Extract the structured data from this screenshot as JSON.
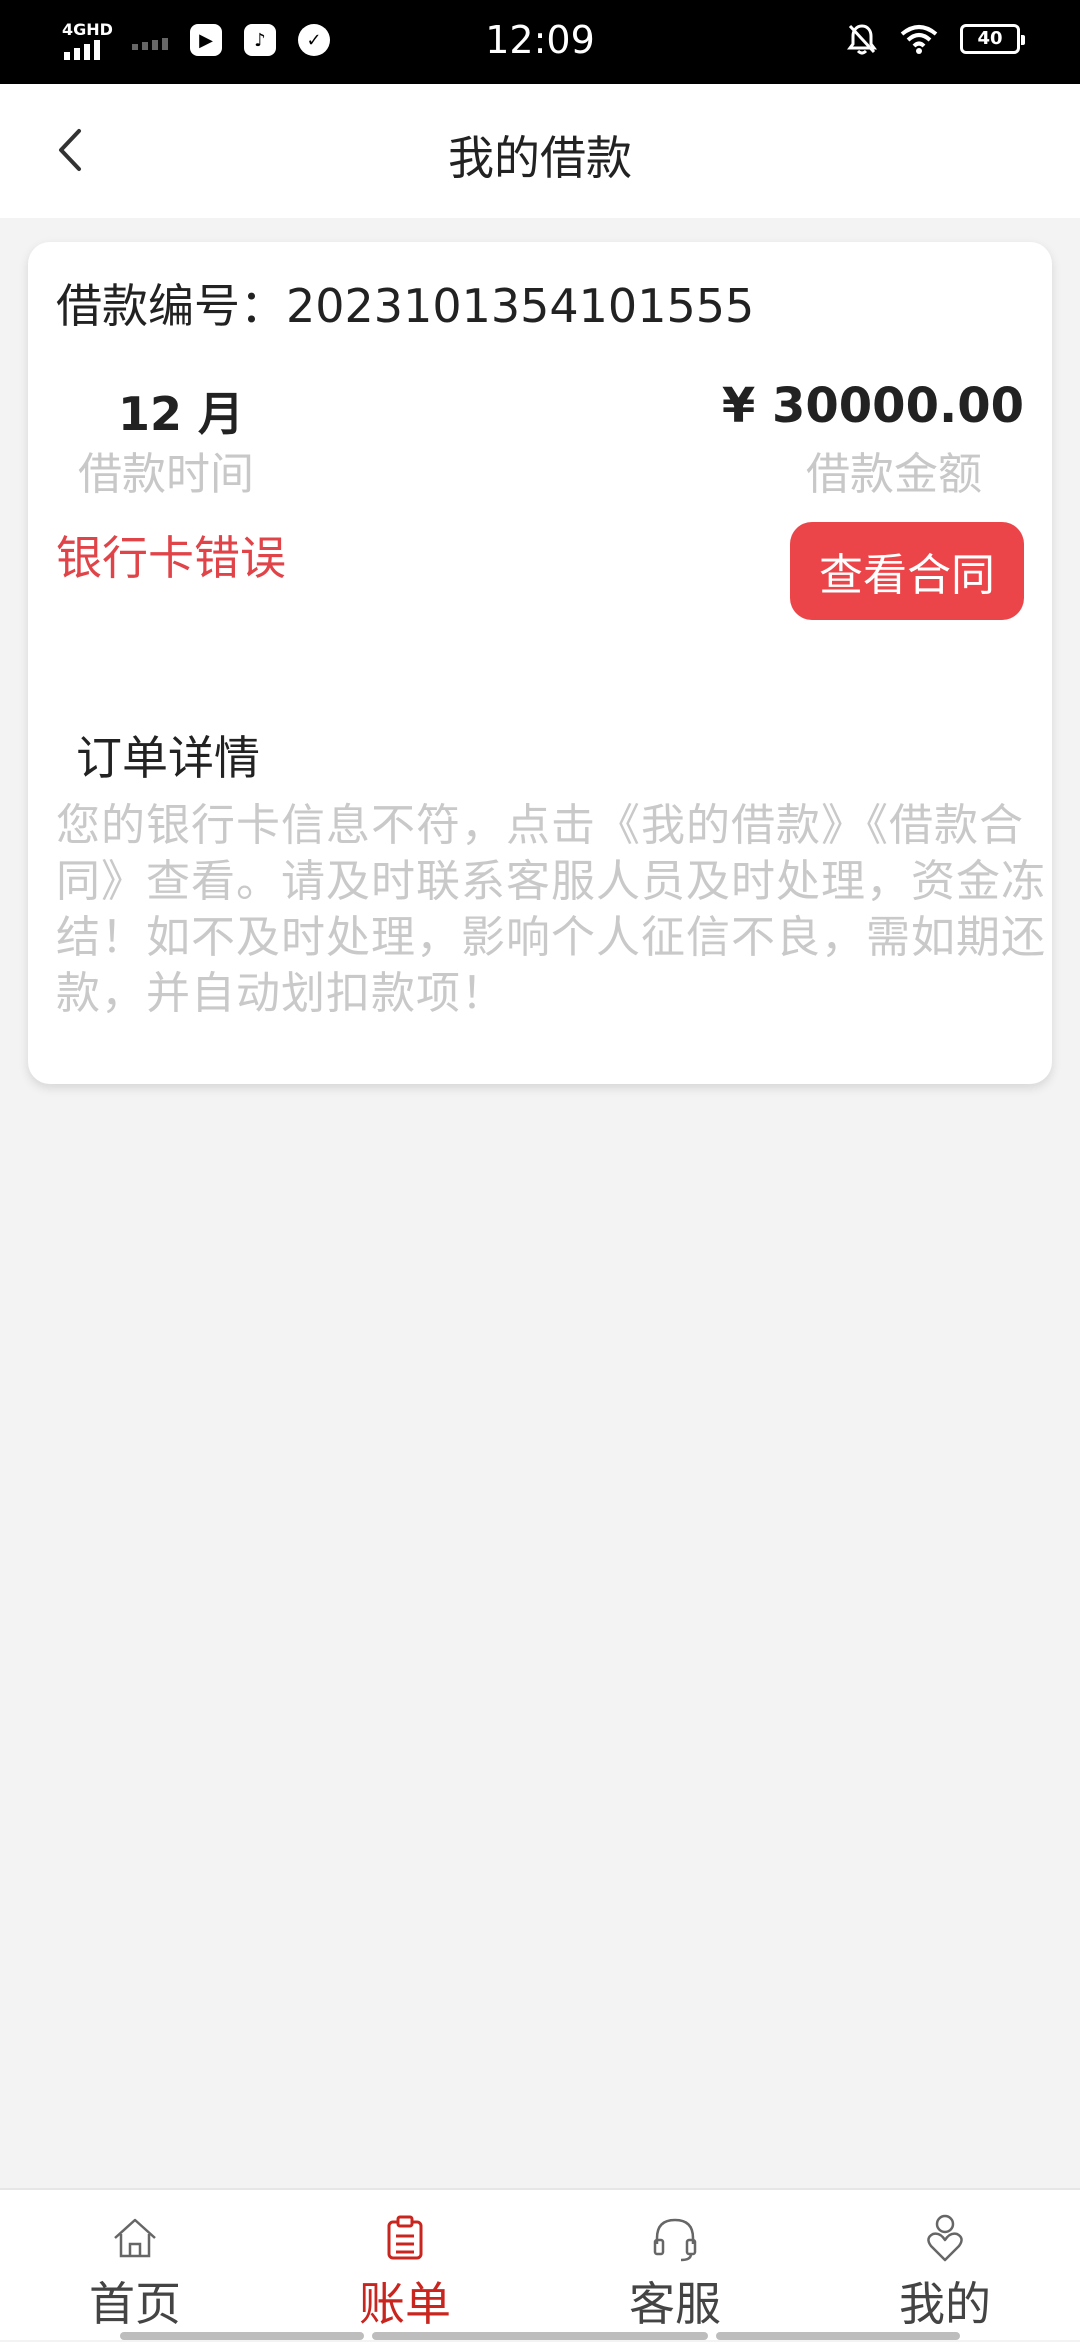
{
  "status_bar": {
    "network": "4GHD",
    "time": "12:09",
    "battery": "40"
  },
  "header": {
    "title": "我的借款"
  },
  "loan": {
    "number_label": "借款编号：",
    "number": "2023101354101555",
    "term_value": "12 月",
    "term_label": "借款时间",
    "amount_value": "¥ 30000.00",
    "amount_label": "借款金额",
    "status": "银行卡错误",
    "contract_button": "查看合同",
    "details_title": "订单详情",
    "details_text": "您的银行卡信息不符，点击《我的借款》《借款合同》查看。请及时联系客服人员及时处理，资金冻结！如不及时处理，影响个人征信不良，需如期还款，并自动划扣款项！"
  },
  "nav": {
    "items": [
      {
        "label": "首页",
        "icon": "home-icon"
      },
      {
        "label": "账单",
        "icon": "bill-icon"
      },
      {
        "label": "客服",
        "icon": "headset-icon"
      },
      {
        "label": "我的",
        "icon": "profile-icon"
      }
    ],
    "active_index": 1,
    "active_color": "#c9251f"
  },
  "colors": {
    "accent": "#eb4549",
    "status_error": "#e04448",
    "muted_text": "#c8c8c8"
  }
}
